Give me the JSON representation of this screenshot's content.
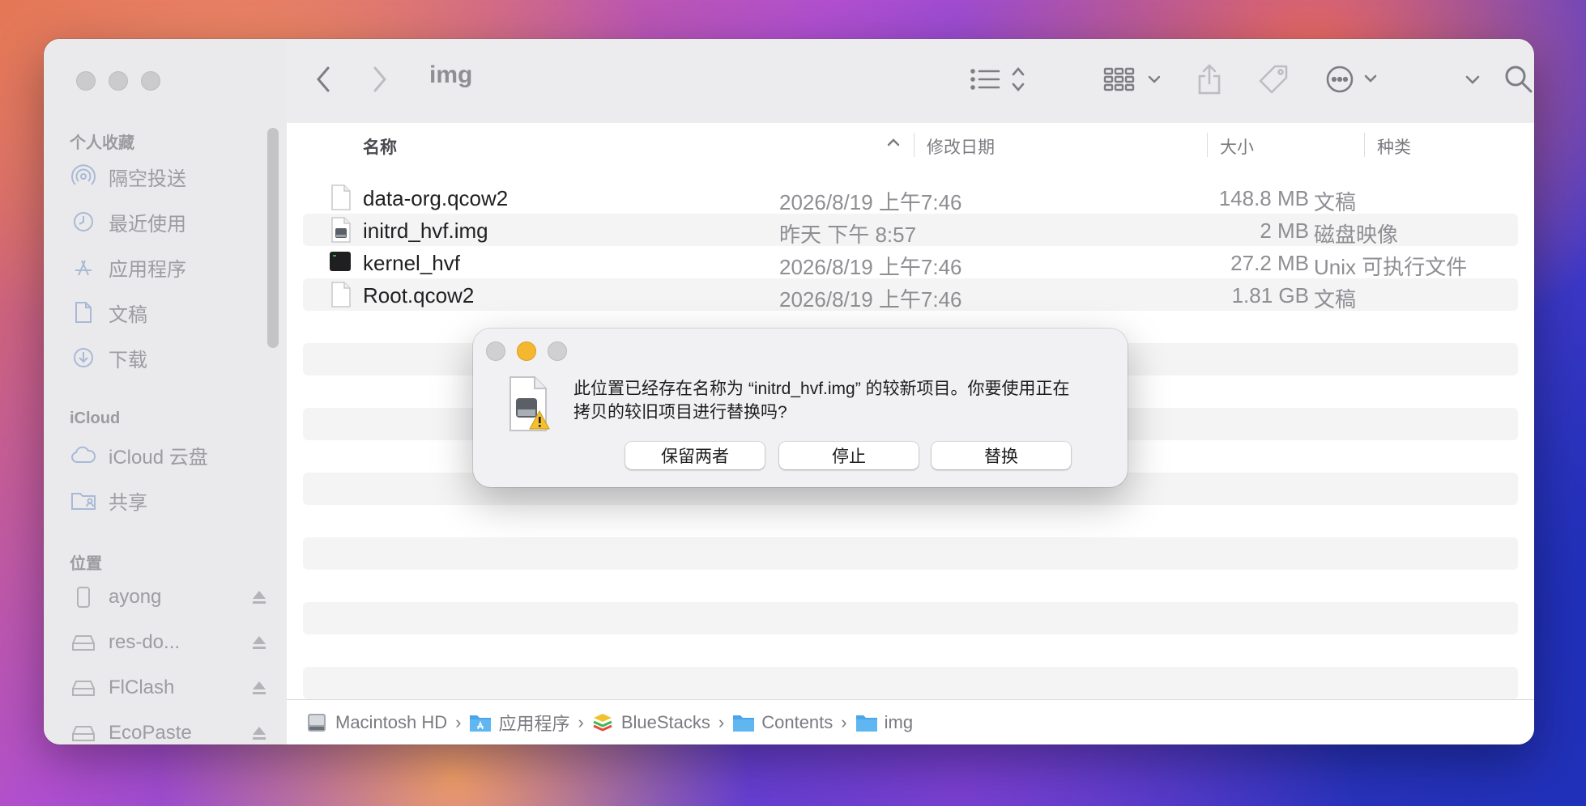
{
  "window": {
    "title": "img"
  },
  "sidebar": {
    "sections": {
      "favorites": "个人收藏",
      "icloud": "iCloud",
      "locations": "位置"
    },
    "favorites": [
      {
        "label": "隔空投送",
        "icon": "airdrop-icon"
      },
      {
        "label": "最近使用",
        "icon": "clock-icon"
      },
      {
        "label": "应用程序",
        "icon": "applications-icon"
      },
      {
        "label": "文稿",
        "icon": "document-icon"
      },
      {
        "label": "下载",
        "icon": "download-icon"
      }
    ],
    "icloud": [
      {
        "label": "iCloud 云盘",
        "icon": "cloud-icon"
      },
      {
        "label": "共享",
        "icon": "shared-folder-icon"
      }
    ],
    "locations": [
      {
        "label": "ayong",
        "icon": "iphone-icon"
      },
      {
        "label": "res-do...",
        "icon": "drive-icon"
      },
      {
        "label": "FlClash",
        "icon": "drive-icon"
      },
      {
        "label": "EcoPaste",
        "icon": "drive-icon"
      }
    ]
  },
  "columns": {
    "name": "名称",
    "date": "修改日期",
    "size": "大小",
    "kind": "种类"
  },
  "files": [
    {
      "name": "data-org.qcow2",
      "date": "2026/8/19 上午7:46",
      "size": "148.8 MB",
      "kind": "文稿",
      "icon": "blank-document-icon"
    },
    {
      "name": "initrd_hvf.img",
      "date": "昨天 下午 8:57",
      "size": "2 MB",
      "kind": "磁盘映像",
      "icon": "disk-image-icon"
    },
    {
      "name": "kernel_hvf",
      "date": "2026/8/19 上午7:46",
      "size": "27.2 MB",
      "kind": "Unix 可执行文件",
      "icon": "terminal-icon"
    },
    {
      "name": "Root.qcow2",
      "date": "2026/8/19 上午7:46",
      "size": "1.81 GB",
      "kind": "文稿",
      "icon": "blank-document-icon"
    }
  ],
  "pathbar": [
    {
      "label": "Macintosh HD",
      "icon": "hard-drive-icon"
    },
    {
      "label": "应用程序",
      "icon": "applications-folder-icon"
    },
    {
      "label": "BlueStacks",
      "icon": "bluestacks-icon"
    },
    {
      "label": "Contents",
      "icon": "folder-icon"
    },
    {
      "label": "img",
      "icon": "folder-icon"
    }
  ],
  "dialog": {
    "message_line1": "此位置已经存在名称为 “initrd_hvf.img” 的较新项目。你要使用正在",
    "message_line2": "拷贝的较旧项目进行替换吗?",
    "buttons": {
      "keep_both": "保留两者",
      "stop": "停止",
      "replace": "替换"
    }
  },
  "colors": {
    "accent_folder": "#4aa6e8",
    "traffic_yellow": "#f5b730",
    "inactive": "#cbcbcd"
  }
}
